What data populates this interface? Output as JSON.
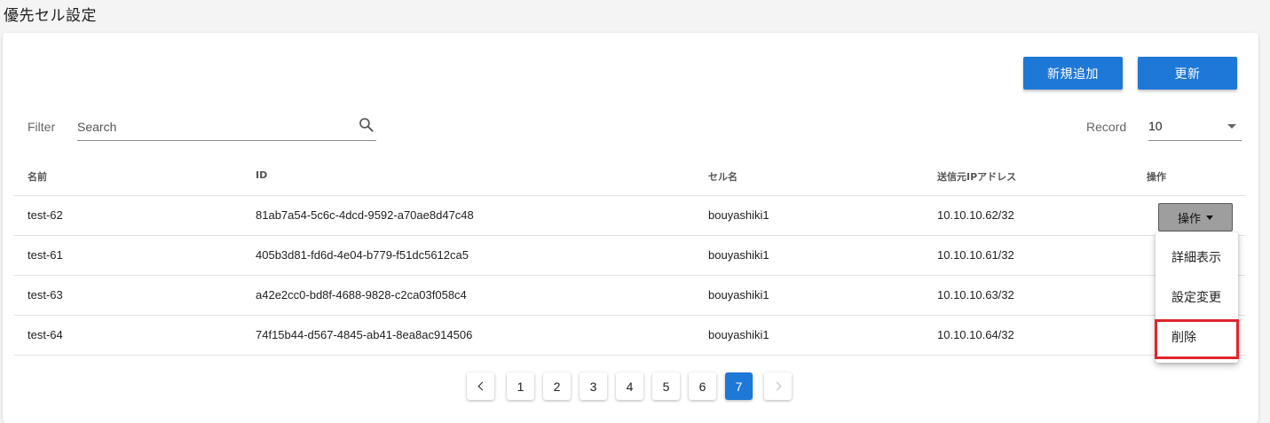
{
  "page": {
    "title": "優先セル設定"
  },
  "toolbar": {
    "add_label": "新規追加",
    "refresh_label": "更新"
  },
  "filter": {
    "label": "Filter",
    "placeholder": "Search",
    "value": ""
  },
  "record": {
    "label": "Record",
    "value": "10"
  },
  "table": {
    "headers": {
      "name": "名前",
      "id": "ID",
      "cell": "セル名",
      "ip": "送信元IPアドレス",
      "op": "操作"
    },
    "rows": [
      {
        "name": "test-62",
        "id": "81ab7a54-5c6c-4dcd-9592-a70ae8d47c48",
        "cell": "bouyashiki1",
        "ip": "10.10.10.62/32"
      },
      {
        "name": "test-61",
        "id": "405b3d81-fd6d-4e04-b779-f51dc5612ca5",
        "cell": "bouyashiki1",
        "ip": "10.10.10.61/32"
      },
      {
        "name": "test-63",
        "id": "a42e2cc0-bd8f-4688-9828-c2ca03f058c4",
        "cell": "bouyashiki1",
        "ip": "10.10.10.63/32"
      },
      {
        "name": "test-64",
        "id": "74f15b44-d567-4845-ab41-8ea8ac914506",
        "cell": "bouyashiki1",
        "ip": "10.10.10.64/32"
      }
    ],
    "op_button_label": "操作"
  },
  "menu": {
    "items": [
      {
        "label": "詳細表示"
      },
      {
        "label": "設定変更"
      },
      {
        "label": "削除"
      }
    ]
  },
  "pagination": {
    "pages": [
      "1",
      "2",
      "3",
      "4",
      "5",
      "6",
      "7"
    ],
    "current": "7"
  },
  "colors": {
    "primary": "#1e78d7",
    "highlight": "#e0242f",
    "op_button_bg": "#9e9e9e"
  }
}
